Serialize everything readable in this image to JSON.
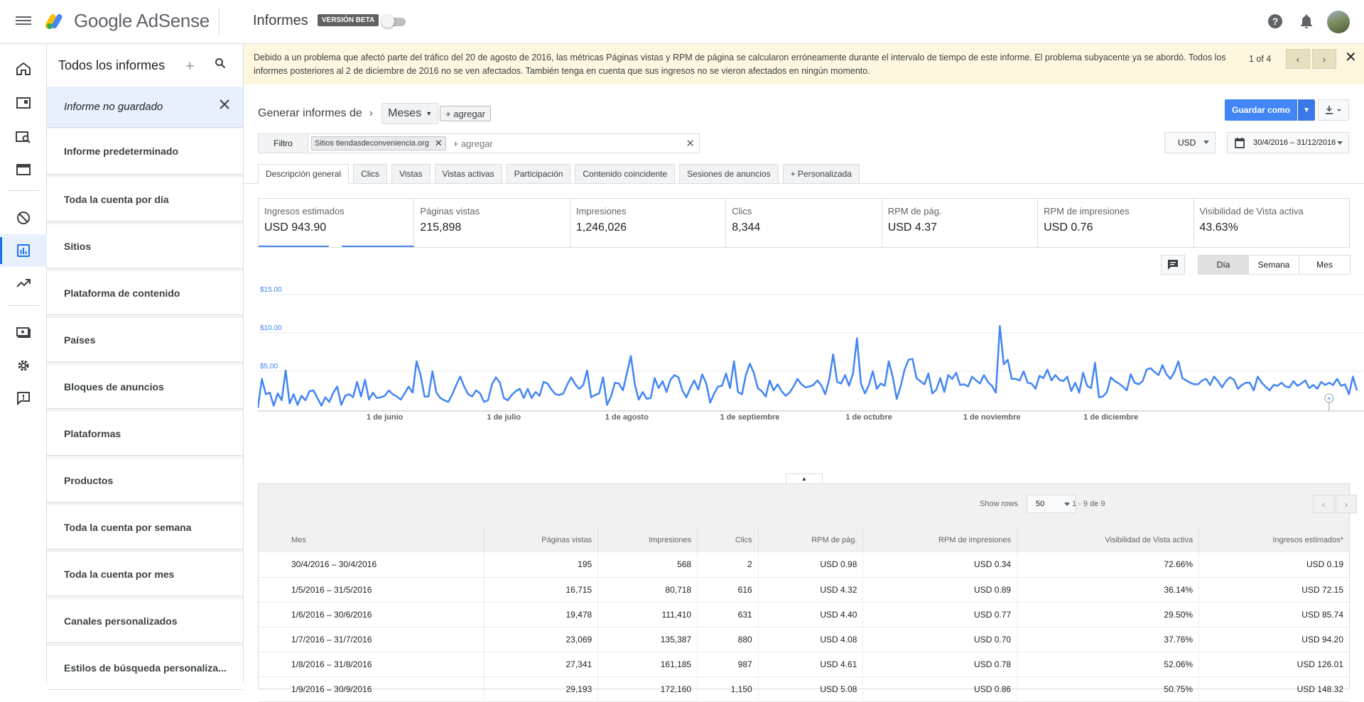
{
  "topbar": {
    "product_name": "Google AdSense",
    "section_title": "Informes",
    "beta_label": "VERSIÓN BETA"
  },
  "reports_panel": {
    "title": "Todos los informes",
    "unsaved_label": "Informe no guardado",
    "items": [
      "Informe predeterminado",
      "Toda la cuenta por día",
      "Sitios",
      "Plataforma de contenido",
      "Países",
      "Bloques de anuncios",
      "Plataformas",
      "Productos",
      "Toda la cuenta por semana",
      "Toda la cuenta por mes",
      "Canales personalizados",
      "Estilos de búsqueda personaliza..."
    ]
  },
  "banner": {
    "text": "Debido a un problema que afectó parte del tráfico del 20 de agosto de 2016, las métricas Páginas vistas y RPM de página se calcularon erróneamente durante el intervalo de tiempo de este informe. El problema subyacente ya se abordó. Todos los informes posteriores al 2 de diciembre de 2016 no se ven afectados. También tenga en cuenta que sus ingresos no se vieron afectados en ningún momento.",
    "counter": "1 of 4"
  },
  "report": {
    "generate_label": "Generar informes de",
    "dimension": "Meses",
    "add_dimension": "+ agregar",
    "save_as": "Guardar como",
    "filter_label": "Filtro",
    "filter_chip_prefix": "Sitios",
    "filter_chip_value": "tiendasdeconveniencia.org",
    "filter_placeholder": "+ agregar",
    "currency": "USD",
    "date_range": "30/4/2016 – 31/12/2016"
  },
  "tabs": [
    "Descripción general",
    "Clics",
    "Vistas",
    "Vistas activas",
    "Participación",
    "Contenido coincidente",
    "Sesiones de anuncios",
    "+ Personalizada"
  ],
  "metrics": [
    {
      "name": "Ingresos estimados",
      "value": "USD 943.90"
    },
    {
      "name": "Páginas vistas",
      "value": "215,898"
    },
    {
      "name": "Impresiones",
      "value": "1,246,026"
    },
    {
      "name": "Clics",
      "value": "8,344"
    },
    {
      "name": "RPM de pág.",
      "value": "USD 4.37"
    },
    {
      "name": "RPM de impresiones",
      "value": "USD 0.76"
    },
    {
      "name": "Visibilidad de Vista activa",
      "value": "43.63%"
    }
  ],
  "granularity": [
    "Día",
    "Semana",
    "Mes"
  ],
  "chart_data": {
    "type": "line",
    "title": "",
    "ylabel": "",
    "ylim": [
      0,
      15
    ],
    "y_ticks": [
      "$15.00",
      "$10.00",
      "$5.00"
    ],
    "x_ticks": [
      "1 de junio",
      "1 de julio",
      "1 de agosto",
      "1 de septiembre",
      "1 de octubre",
      "1 de noviembre",
      "1 de diciembre"
    ],
    "x_start": "2016-04-30",
    "series": [
      {
        "values": [
          0.2,
          4.0,
          2.0,
          2.2,
          0.5,
          2.1,
          1.2,
          5.1,
          0.8,
          2.0,
          0.6,
          1.8,
          1.2,
          2.4,
          2.5,
          1.5,
          0.5,
          1.6,
          1.0,
          2.2,
          3.0,
          0.6,
          1.8,
          2.0,
          1.6,
          3.6,
          1.7,
          3.9,
          1.3,
          2.2,
          1.5,
          1.6,
          1.8,
          2.5,
          2.0,
          1.7,
          1.3,
          2.1,
          3.0,
          2.2,
          6.3,
          4.5,
          1.7,
          1.7,
          5.0,
          2.2,
          1.5,
          1.2,
          1.0,
          2.0,
          3.2,
          4.3,
          3.0,
          2.0,
          1.7,
          2.5,
          2.1,
          1.0,
          1.2,
          3.3,
          4.2,
          3.5,
          1.5,
          1.2,
          1.9,
          2.4,
          2.7,
          1.5,
          2.7,
          1.5,
          2.3,
          1.8,
          3.6,
          3.4,
          2.6,
          2.0,
          1.9,
          2.1,
          3.3,
          4.2,
          3.3,
          2.7,
          3.2,
          5.1,
          1.6,
          1.9,
          2.1,
          4.2,
          0.6,
          1.7,
          3.5,
          3.4,
          2.5,
          4.7,
          7.0,
          3.3,
          1.3,
          2.3,
          1.4,
          1.5,
          4.1,
          2.8,
          3.7,
          2.3,
          3.9,
          4.5,
          4.2,
          2.5,
          1.6,
          2.8,
          3.8,
          2.6,
          4.6,
          3.4,
          0.9,
          2.1,
          3.0,
          3.1,
          4.7,
          2.8,
          6.3,
          2.3,
          2.0,
          4.5,
          6.0,
          4.8,
          2.8,
          2.4,
          1.7,
          3.8,
          2.5,
          3.3,
          2.4,
          1.8,
          2.2,
          3.0,
          4.0,
          3.3,
          2.9,
          3.0,
          3.2,
          3.8,
          3.2,
          2.0,
          3.9,
          7.2,
          3.6,
          3.4,
          4.5,
          3.1,
          4.7,
          9.3,
          3.4,
          2.1,
          3.2,
          5.0,
          2.7,
          3.4,
          3.1,
          6.3,
          4.3,
          1.4,
          3.0,
          5.2,
          6.5,
          6.6,
          4.1,
          3.7,
          3.3,
          4.7,
          2.1,
          2.6,
          4.1,
          2.3,
          4.5,
          4.0,
          4.8,
          3.2,
          3.3,
          3.0,
          4.3,
          3.8,
          3.4,
          4.5,
          3.6,
          3.1,
          2.2,
          10.9,
          5.9,
          6.5,
          4.0,
          4.0,
          3.8,
          5.0,
          3.5,
          3.4,
          2.7,
          4.4,
          4.1,
          5.2,
          3.8,
          4.5,
          3.9,
          3.7,
          4.3,
          2.4,
          3.5,
          2.2,
          4.8,
          3.1,
          2.8,
          6.1,
          1.6,
          1.7,
          2.3,
          4.2,
          3.7,
          3.4,
          3.0,
          2.5,
          4.6,
          3.5,
          3.3,
          3.7,
          5.2,
          5.4,
          4.9,
          4.5,
          5.8,
          4.6,
          4.0,
          4.9,
          6.3,
          4.1,
          3.8,
          3.5,
          3.3,
          3.3,
          3.8,
          4.0,
          3.2,
          4.3,
          3.7,
          2.9,
          3.7,
          4.2,
          3.9,
          2.7,
          3.2,
          3.5,
          3.5,
          2.5,
          4.3,
          3.5,
          3.0,
          2.5,
          3.2,
          3.1,
          3.5,
          3.0,
          2.9,
          3.7,
          3.1,
          3.4,
          3.8,
          2.8,
          3.2,
          2.7,
          3.6,
          3.2,
          3.5,
          3.2,
          4.0,
          3.1,
          3.3,
          2.0,
          4.3,
          2.5
        ]
      }
    ]
  },
  "table": {
    "show_rows_label": "Show rows",
    "rows_value": "50",
    "pagination": "1 - 9 de 9",
    "columns": [
      "Mes",
      "Páginas vistas",
      "Impresiones",
      "Clics",
      "RPM de pág.",
      "RPM de impresiones",
      "Visibilidad de Vista activa",
      "Ingresos estimados*"
    ],
    "rows": [
      [
        "30/4/2016 – 30/4/2016",
        "195",
        "568",
        "2",
        "USD 0.98",
        "USD 0.34",
        "72.66%",
        "USD 0.19"
      ],
      [
        "1/5/2016 – 31/5/2016",
        "16,715",
        "80,718",
        "616",
        "USD 4.32",
        "USD 0.89",
        "36.14%",
        "USD 72.15"
      ],
      [
        "1/6/2016 – 30/6/2016",
        "19,478",
        "111,410",
        "631",
        "USD 4.40",
        "USD 0.77",
        "29.50%",
        "USD 85.74"
      ],
      [
        "1/7/2016 – 31/7/2016",
        "23,069",
        "135,387",
        "880",
        "USD 4.08",
        "USD 0.70",
        "37.76%",
        "USD 94.20"
      ],
      [
        "1/8/2016 – 31/8/2016",
        "27,341",
        "161,185",
        "987",
        "USD 4.61",
        "USD 0.78",
        "52.06%",
        "USD 126.01"
      ],
      [
        "1/9/2016 – 30/9/2016",
        "29,193",
        "172,160",
        "1,150",
        "USD 5.08",
        "USD 0.86",
        "50.75%",
        "USD 148.32"
      ]
    ]
  }
}
